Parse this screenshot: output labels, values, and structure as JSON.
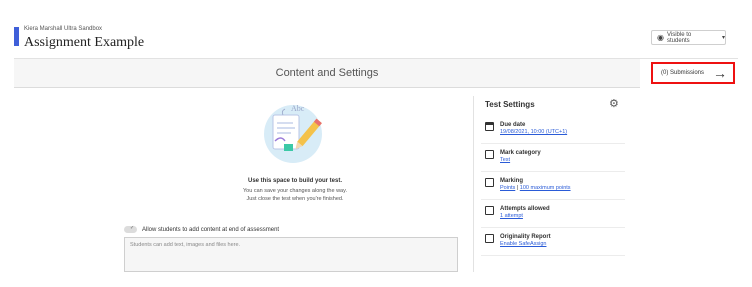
{
  "header": {
    "course_name": "Kiera Marshall Ultra Sandbox",
    "title": "Assignment Example",
    "visibility_label": "Visible to students",
    "visibility_icon": "eye-icon"
  },
  "content_band": {
    "title": "Content and Settings"
  },
  "submissions": {
    "label": "(0) Submissions",
    "icon": "arrow-right-icon"
  },
  "main": {
    "illustration_text": "Abc",
    "build_title": "Use this space to build your test.",
    "build_line1": "You can save your changes along the way.",
    "build_line2": "Just close the test when you're finished.",
    "toggle_label": "Allow students to add content at end of assessment",
    "textarea_placeholder": "Students can add text, images and files here."
  },
  "settings": {
    "title": "Test Settings",
    "items": [
      {
        "label": "Due date",
        "value": "19/08/2021, 10:00 (UTC+1)",
        "icon": "calendar-icon"
      },
      {
        "label": "Mark category",
        "value": "Test",
        "icon": "category-icon"
      },
      {
        "label": "Marking",
        "value_a": "Points",
        "value_sep": " | ",
        "value_b": "100 maximum points",
        "icon": "marking-icon"
      },
      {
        "label": "Attempts allowed",
        "value": "1 attempt",
        "icon": "checkbox-icon"
      },
      {
        "label": "Originality Report",
        "value": "Enable SafeAssign",
        "icon": "report-icon"
      }
    ]
  },
  "colors": {
    "accent": "#3f5fd9",
    "highlight_box": "#e11111",
    "link": "#2a5bd7"
  }
}
